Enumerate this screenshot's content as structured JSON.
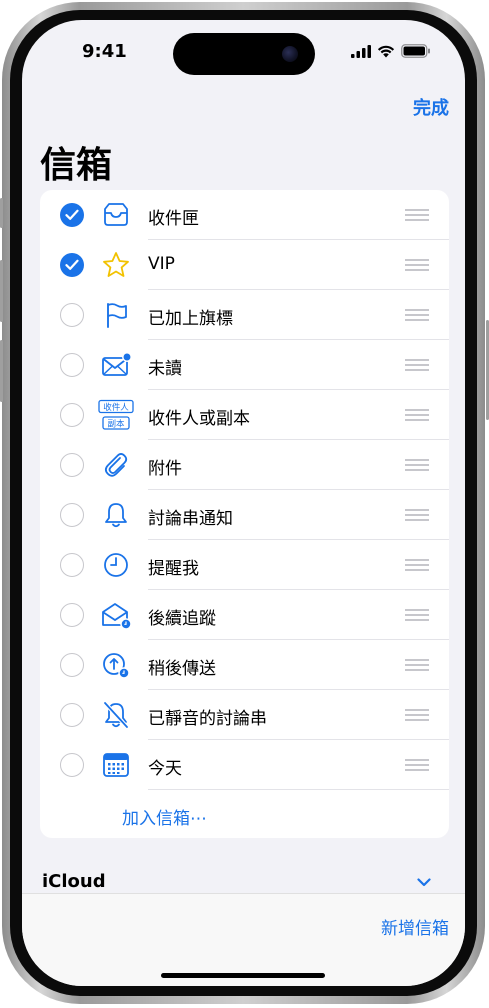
{
  "status": {
    "time": "9:41"
  },
  "header": {
    "done_label": "完成",
    "title": "信箱"
  },
  "colors": {
    "accent": "#1a73e8",
    "vip_star": "#f2c200",
    "separator": "#e3e3e8"
  },
  "mailboxes": [
    {
      "label": "收件匣",
      "checked": true,
      "icon": "inbox-icon"
    },
    {
      "label": "VIP",
      "checked": true,
      "icon": "star-icon"
    },
    {
      "label": "已加上旗標",
      "checked": false,
      "icon": "flag-icon"
    },
    {
      "label": "未讀",
      "checked": false,
      "icon": "unread-envelope-icon"
    },
    {
      "label": "收件人或副本",
      "checked": false,
      "icon": "to-cc-icon",
      "icon_text_top": "收件人",
      "icon_text_bottom": "副本"
    },
    {
      "label": "附件",
      "checked": false,
      "icon": "paperclip-icon"
    },
    {
      "label": "討論串通知",
      "checked": false,
      "icon": "bell-icon"
    },
    {
      "label": "提醒我",
      "checked": false,
      "icon": "clock-icon"
    },
    {
      "label": "後續追蹤",
      "checked": false,
      "icon": "follow-up-icon"
    },
    {
      "label": "稍後傳送",
      "checked": false,
      "icon": "send-later-icon"
    },
    {
      "label": "已靜音的討論串",
      "checked": false,
      "icon": "muted-bell-icon"
    },
    {
      "label": "今天",
      "checked": false,
      "icon": "calendar-icon"
    }
  ],
  "add_mailbox_label": "加入信箱⋯",
  "account": {
    "label": "iCloud"
  },
  "bottom": {
    "new_mailbox_label": "新增信箱"
  }
}
